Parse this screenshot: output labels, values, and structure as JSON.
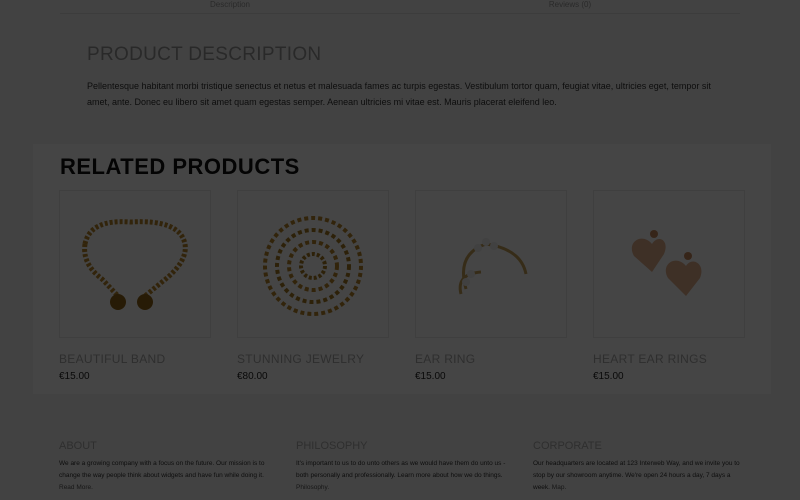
{
  "tabs": [
    "Description",
    "Reviews (0)"
  ],
  "description": {
    "title": "PRODUCT DESCRIPTION",
    "text": "Pellentesque habitant morbi tristique senectus et netus et malesuada fames ac turpis egestas. Vestibulum tortor quam, feugiat vitae, ultricies eget, tempor sit amet, ante. Donec eu libero sit amet quam egestas semper. Aenean ultricies mi vitae est. Mauris placerat eleifend leo."
  },
  "related": {
    "title": "RELATED PRODUCTS",
    "products": [
      {
        "name": "BEAUTIFUL BAND",
        "price": "€15.00",
        "icon": "gold-band-necklace"
      },
      {
        "name": "STUNNING JEWELRY",
        "price": "€80.00",
        "icon": "gold-chain-necklace"
      },
      {
        "name": "EAR RING",
        "price": "€15.00",
        "icon": "pearl-ear-ring"
      },
      {
        "name": "HEART EAR RINGS",
        "price": "€15.00",
        "icon": "heart-ear-rings"
      }
    ]
  },
  "footer": {
    "about": {
      "title": "ABOUT",
      "text": "We are a growing company with a focus on the future. Our mission is to change the way people think about widgets and have fun while doing it.",
      "link": "Read More."
    },
    "philosophy": {
      "title": "PHILOSOPHY",
      "text": "It's important to us to do unto others as we would have them do unto us - both personally and professionally. Learn more about how we do things.",
      "link": "Philosophy."
    },
    "corporate": {
      "title": "CORPORATE",
      "text": "Our headquarters are located at 123 Interweb Way, and we invite you to stop by our showroom anytime. We're open 24 hours a day, 7 days a week.",
      "link": "Map."
    }
  },
  "colors": {
    "overlay": "#000000",
    "title": "#111111",
    "muted": "#aaaaaa",
    "gold": "#b8862b"
  }
}
